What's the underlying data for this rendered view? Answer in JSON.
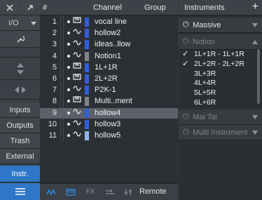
{
  "toolbar": {
    "io_label": "I/O",
    "buttons": [
      {
        "label": "Inputs",
        "active": false
      },
      {
        "label": "Outputs",
        "active": false
      },
      {
        "label": "Trash",
        "active": false
      },
      {
        "label": "External",
        "active": false
      },
      {
        "label": "Instr.",
        "active": true
      }
    ]
  },
  "track_list": {
    "headers": {
      "num": "#",
      "channel": "Channel",
      "group": "Group"
    },
    "rows": [
      {
        "num": "1",
        "icon": "keyboard-icon",
        "color": "#2f5fd9",
        "name": "vocal line",
        "selected": false
      },
      {
        "num": "2",
        "icon": "waveform-icon",
        "color": "#2f5fd9",
        "name": "hollow2",
        "selected": false
      },
      {
        "num": "3",
        "icon": "waveform-icon",
        "color": "#2f5fd9",
        "name": "ideas..llow",
        "selected": false
      },
      {
        "num": "4",
        "icon": "waveform-icon",
        "color": "#7e848a",
        "name": "Notion1",
        "selected": false
      },
      {
        "num": "5",
        "icon": "keyboard-icon",
        "color": "#2f5fd9",
        "name": "1L+1R",
        "selected": false
      },
      {
        "num": "6",
        "icon": "keyboard-icon",
        "color": "#2f5fd9",
        "name": "2L+2R",
        "selected": false
      },
      {
        "num": "7",
        "icon": "waveform-icon",
        "color": "#2f5fd9",
        "name": "P2K-1",
        "selected": false
      },
      {
        "num": "8",
        "icon": "keyboard-icon",
        "color": "#7e848a",
        "name": "Multi..ment",
        "selected": false
      },
      {
        "num": "9",
        "icon": "waveform-icon",
        "color": "#2f5fd9",
        "name": "hollow4",
        "selected": true
      },
      {
        "num": "10",
        "icon": "waveform-icon",
        "color": "#2f5fd9",
        "name": "hollow3",
        "selected": false
      },
      {
        "num": "11",
        "icon": "waveform-icon",
        "color": "#8fb6ee",
        "name": "hollow5",
        "selected": false
      }
    ],
    "footer": {
      "fx": "FX",
      "remote": "Remote"
    }
  },
  "instruments": {
    "title": "Instruments",
    "add": "+",
    "items": [
      {
        "name": "Massive",
        "enabled": true
      },
      {
        "name": "Notion",
        "enabled": false
      },
      {
        "name": "Mai Tai",
        "enabled": false
      },
      {
        "name": "Multi Instrument",
        "enabled": false
      }
    ],
    "notion_outputs": [
      {
        "label": "1L+1R - 1L+1R",
        "checked": true
      },
      {
        "label": "2L+2R - 2L+2R",
        "checked": true
      },
      {
        "label": "3L+3R",
        "checked": false
      },
      {
        "label": "4L+4R",
        "checked": false
      },
      {
        "label": "5L+5R",
        "checked": false
      },
      {
        "label": "6L+6R",
        "checked": false
      }
    ]
  },
  "colors": {
    "accent": "#2e77c7",
    "selected_row": "#5a6169"
  }
}
